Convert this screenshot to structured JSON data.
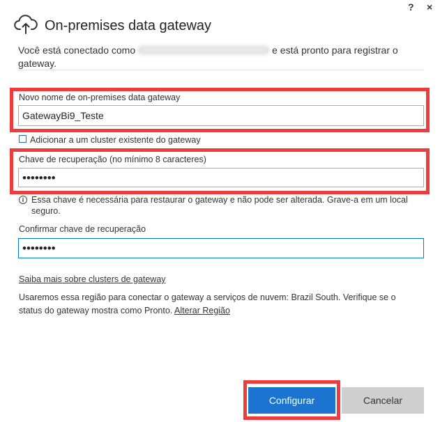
{
  "window": {
    "help_label": "?",
    "close_label": "×"
  },
  "header": {
    "title": "On-premises data gateway",
    "intro_before": "Você está conectado como",
    "intro_after": "e está pronto para registrar o gateway."
  },
  "form": {
    "name_label": "Novo nome de on-premises data gateway",
    "name_value": "GatewayBi9_Teste",
    "cluster_checkbox_label": "Adicionar a um cluster existente do gateway",
    "cluster_checked": false,
    "key_label": "Chave de recuperação (no mínimo 8 caracteres)",
    "key_value": "••••••••",
    "key_info": "Essa chave é necessária para restaurar o gateway e não pode ser alterada. Grave-a em um local seguro.",
    "confirm_label": "Confirmar chave de recuperação",
    "confirm_value": "••••••••"
  },
  "footer": {
    "learn_more_link": "Saiba mais sobre clusters de gateway",
    "region_text": "Usaremos essa região para conectar o gateway a serviços de nuvem: Brazil South. Verifique se o status do gateway mostra como Pronto.",
    "change_region_link": "Alterar Região"
  },
  "buttons": {
    "configure": "Configurar",
    "cancel": "Cancelar"
  },
  "colors": {
    "accent": "#1b75d0",
    "annotation": "#ee3b3b",
    "focus_border": "#0078d7"
  },
  "icons": {
    "logo": "cloud-upload-icon",
    "info": "info-icon",
    "help": "help-icon",
    "close": "close-icon"
  }
}
